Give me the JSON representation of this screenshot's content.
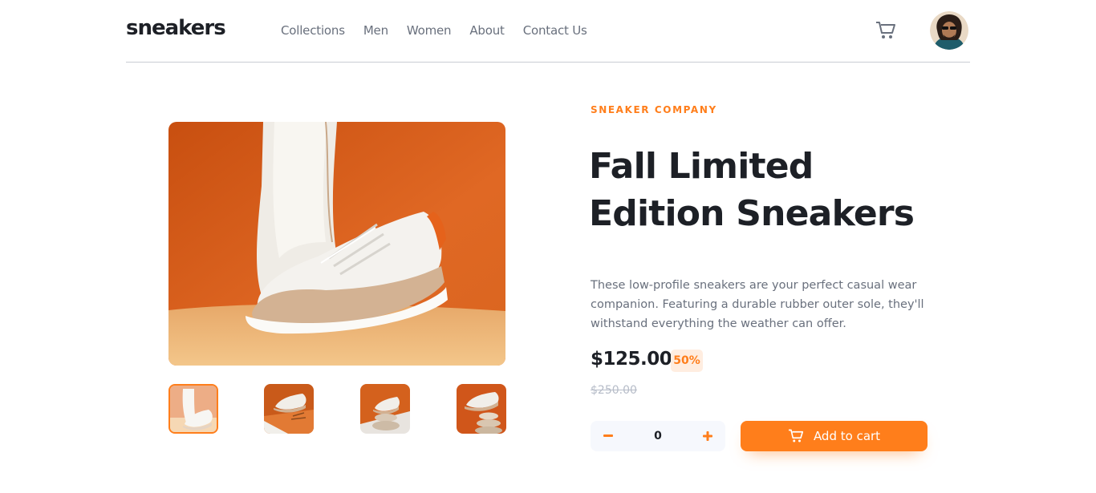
{
  "brand": {
    "logo": "sneakers"
  },
  "nav": {
    "items": [
      {
        "label": "Collections"
      },
      {
        "label": "Men"
      },
      {
        "label": "Women"
      },
      {
        "label": "About"
      },
      {
        "label": "Contact Us"
      }
    ]
  },
  "header": {
    "cart_icon": "cart-icon",
    "avatar": "avatar"
  },
  "gallery": {
    "main_image": "sneaker-product-photo",
    "thumbnails": [
      {
        "name": "thumbnail-1",
        "active": true
      },
      {
        "name": "thumbnail-2",
        "active": false
      },
      {
        "name": "thumbnail-3",
        "active": false
      },
      {
        "name": "thumbnail-4",
        "active": false
      }
    ]
  },
  "product": {
    "company": "SNEAKER COMPANY",
    "title_line1": "Fall Limited",
    "title_line2": "Edition Sneakers",
    "description": "These low-profile sneakers are your perfect casual wear companion. Featuring a durable rubber outer sole, they'll withstand everything the weather can offer.",
    "price": "$125.00",
    "discount": "50%",
    "original_price": "$250.00"
  },
  "cart_controls": {
    "quantity": "0",
    "minus_icon": "minus-icon",
    "plus_icon": "plus-icon",
    "add_label": "Add to cart"
  },
  "colors": {
    "accent": "#ff7e1b",
    "accent_pale": "#ffede0",
    "text_dark": "#1d2026",
    "text_gray": "#69707d",
    "text_light": "#b6bcc8",
    "quantity_bg": "#f6f8fd"
  }
}
